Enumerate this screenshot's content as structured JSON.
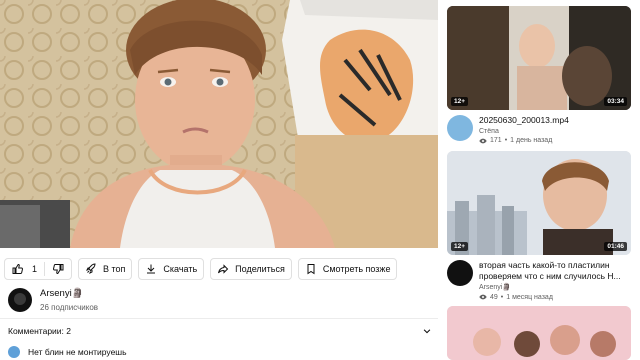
{
  "actions": {
    "like_count": "1",
    "to_top_label": "В топ",
    "download_label": "Скачать",
    "share_label": "Поделиться",
    "watch_later_label": "Смотреть позже"
  },
  "channel": {
    "name": "Arsenyi🗿",
    "subscribers": "26 подписчиков"
  },
  "comments": {
    "header_label": "Комментарии:",
    "count": "2",
    "preview_text": "Нет блин не монтируешь"
  },
  "sidebar": {
    "items": [
      {
        "title": "20250630_200013.mp4",
        "channel": "Стёпа",
        "views": "171",
        "age": "1 день назад",
        "age_badge": "12+",
        "duration": "03:34"
      },
      {
        "title": "вторая часть какой-то пластилин проверяем что с ним случилось Н...",
        "channel": "Arsenyi🗿",
        "views": "49",
        "age": "1 месяц назад",
        "age_badge": "12+",
        "duration": "01:46"
      },
      {
        "title": "",
        "channel": "",
        "views": "",
        "age": "",
        "age_badge": "",
        "duration": ""
      }
    ]
  },
  "colors": {
    "accent_text": "#0f0f0f",
    "secondary_text": "#606060",
    "border": "#e0e0e0"
  }
}
